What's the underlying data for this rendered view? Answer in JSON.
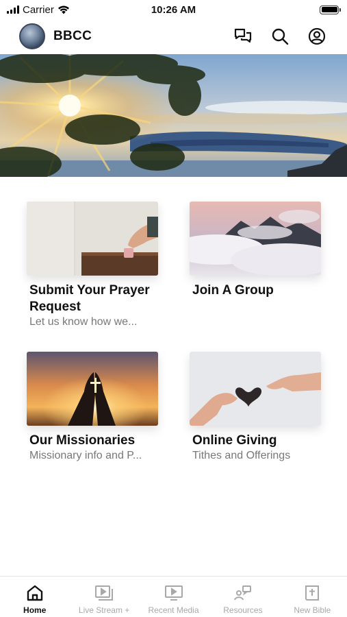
{
  "status_bar": {
    "carrier": "Carrier",
    "time": "10:26 AM",
    "icons": [
      "signal-icon",
      "wifi-icon",
      "battery-icon"
    ]
  },
  "header": {
    "title": "BBCC",
    "icons": [
      "chat-icon",
      "search-icon",
      "profile-icon"
    ]
  },
  "cards": [
    {
      "title": "Submit Your Prayer Request",
      "subtitle": "Let us know how we..."
    },
    {
      "title": "Join A Group",
      "subtitle": ""
    },
    {
      "title": "Our Missionaries",
      "subtitle": "Missionary info and P..."
    },
    {
      "title": "Online Giving",
      "subtitle": "Tithes and Offerings"
    }
  ],
  "tabs": [
    {
      "label": "Home",
      "icon": "home-icon",
      "active": true
    },
    {
      "label": "Live Stream +",
      "icon": "live-stream-icon",
      "active": false
    },
    {
      "label": "Recent Media",
      "icon": "media-icon",
      "active": false
    },
    {
      "label": "Resources",
      "icon": "resources-icon",
      "active": false
    },
    {
      "label": "New Bible",
      "icon": "bible-icon",
      "active": false
    }
  ],
  "colors": {
    "active_tab": "#111111",
    "inactive_tab": "#a8a8a8",
    "subtitle": "#777777"
  }
}
